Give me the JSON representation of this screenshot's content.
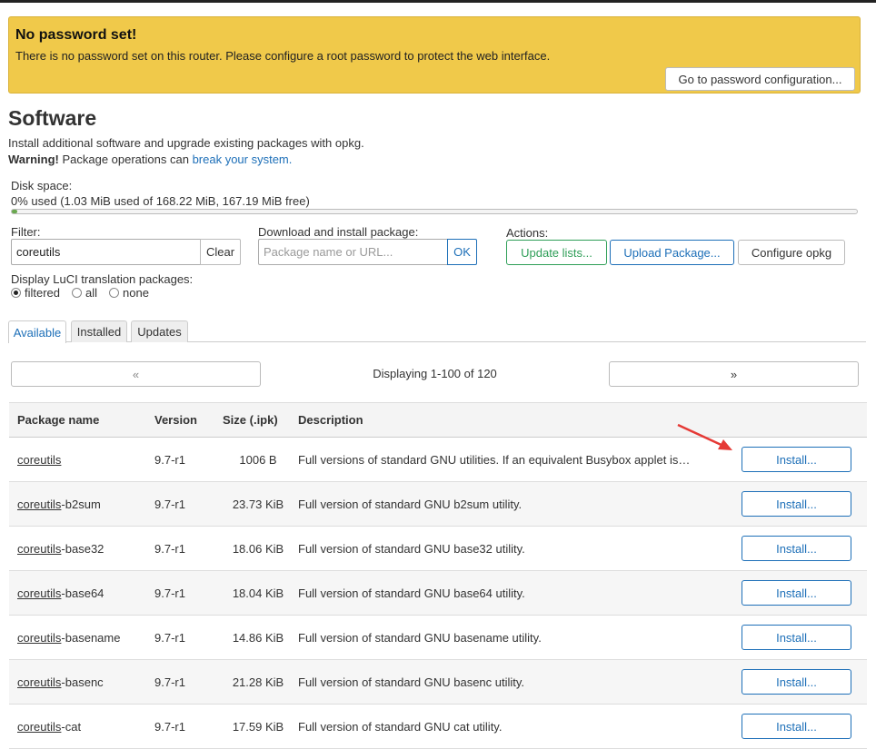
{
  "alert": {
    "title": "No password set!",
    "text": "There is no password set on this router. Please configure a root password to protect the web interface.",
    "button": "Go to password configuration..."
  },
  "page": {
    "title": "Software",
    "description": "Install additional software and upgrade existing packages with opkg.",
    "warning_bold": "Warning!",
    "warning_text": " Package operations can ",
    "warning_link": "break your system."
  },
  "disk": {
    "label": "Disk space:",
    "value": "0% used (1.03 MiB used of 168.22 MiB, 167.19 MiB free)",
    "used_percent": 0.6
  },
  "filter": {
    "label": "Filter:",
    "value": "coreutils",
    "clear": "Clear"
  },
  "download": {
    "label": "Download and install package:",
    "placeholder": "Package name or URL...",
    "ok": "OK"
  },
  "actions": {
    "label": "Actions:",
    "update": "Update lists...",
    "upload": "Upload Package...",
    "configure": "Configure opkg"
  },
  "translation": {
    "label": "Display LuCI translation packages:",
    "options": [
      "filtered",
      "all",
      "none"
    ],
    "selected": "filtered"
  },
  "tabs": [
    "Available",
    "Installed",
    "Updates"
  ],
  "pager": {
    "prev": "«",
    "next": "»",
    "info": "Displaying 1-100 of 120"
  },
  "table": {
    "headers": [
      "Package name",
      "Version",
      "Size (.ipk)",
      "Description"
    ],
    "install_label": "Install...",
    "rows": [
      {
        "name_match": "coreutils",
        "name_rest": "",
        "version": "9.7-r1",
        "size": "1006 B",
        "description": "Full versions of standard GNU utilities. If an equivalent Busybox applet is…"
      },
      {
        "name_match": "coreutils",
        "name_rest": "-b2sum",
        "version": "9.7-r1",
        "size": "23.73 KiB",
        "description": "Full version of standard GNU b2sum utility."
      },
      {
        "name_match": "coreutils",
        "name_rest": "-base32",
        "version": "9.7-r1",
        "size": "18.06 KiB",
        "description": "Full version of standard GNU base32 utility."
      },
      {
        "name_match": "coreutils",
        "name_rest": "-base64",
        "version": "9.7-r1",
        "size": "18.04 KiB",
        "description": "Full version of standard GNU base64 utility."
      },
      {
        "name_match": "coreutils",
        "name_rest": "-basename",
        "version": "9.7-r1",
        "size": "14.86 KiB",
        "description": "Full version of standard GNU basename utility."
      },
      {
        "name_match": "coreutils",
        "name_rest": "-basenc",
        "version": "9.7-r1",
        "size": "21.28 KiB",
        "description": "Full version of standard GNU basenc utility."
      },
      {
        "name_match": "coreutils",
        "name_rest": "-cat",
        "version": "9.7-r1",
        "size": "17.59 KiB",
        "description": "Full version of standard GNU cat utility."
      }
    ]
  },
  "colors": {
    "alert_bg": "#f0c94a",
    "link": "#1d6fb8",
    "update_green": "#2e9e57",
    "arrow_red": "#e53935"
  }
}
